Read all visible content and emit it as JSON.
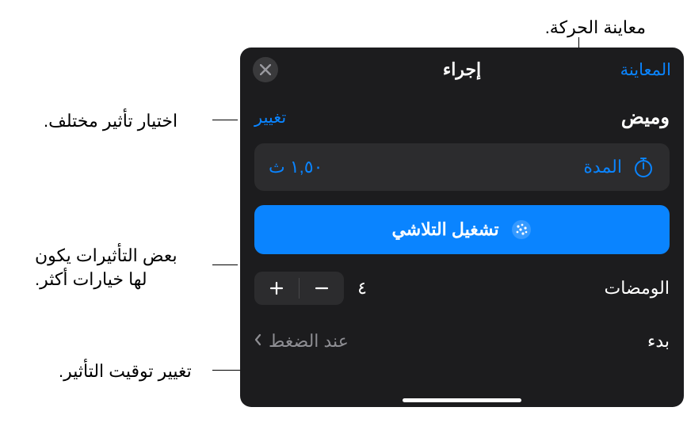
{
  "callouts": {
    "preview": "معاينة الحركة.",
    "change": "اختيار تأثير مختلف.",
    "options": "بعض التأثيرات يكون\nلها خيارات أكثر.",
    "timing": "تغيير توقيت التأثير."
  },
  "header": {
    "title": "إجراء",
    "preview_link": "المعاينة"
  },
  "effect": {
    "name": "وميض",
    "change_label": "تغيير"
  },
  "duration": {
    "label": "المدة",
    "value": "١,٥٠ ث"
  },
  "fade_button": {
    "label": "تشغيل التلاشي"
  },
  "flashes": {
    "label": "الومضات",
    "value": "٤"
  },
  "start": {
    "label": "بدء",
    "value": "عند الضغط"
  }
}
